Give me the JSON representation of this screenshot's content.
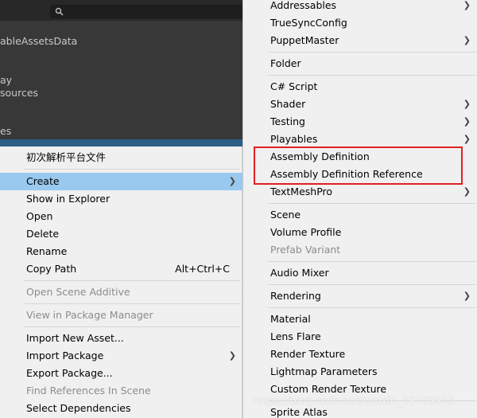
{
  "editor": {
    "search_placeholder": "",
    "labels": [
      "ableAssetsData",
      "ay",
      "sources",
      "es"
    ]
  },
  "main_menu": {
    "items": [
      {
        "label": "初次解析平台文件"
      },
      {
        "label": "Create",
        "submenu": true
      },
      {
        "label": "Show in Explorer"
      },
      {
        "label": "Open"
      },
      {
        "label": "Delete"
      },
      {
        "label": "Rename"
      },
      {
        "label": "Copy Path",
        "shortcut": "Alt+Ctrl+C"
      },
      {
        "label": "Open Scene Additive",
        "disabled": true
      },
      {
        "label": "View in Package Manager",
        "disabled": true
      },
      {
        "label": "Import New Asset..."
      },
      {
        "label": "Import Package",
        "submenu": true
      },
      {
        "label": "Export Package..."
      },
      {
        "label": "Find References In Scene",
        "disabled": true
      },
      {
        "label": "Select Dependencies"
      }
    ]
  },
  "create_submenu": {
    "items": [
      {
        "label": "Addressables",
        "submenu": true
      },
      {
        "label": "TrueSyncConfig"
      },
      {
        "label": "PuppetMaster",
        "submenu": true
      },
      {
        "label": "Folder"
      },
      {
        "label": "C# Script"
      },
      {
        "label": "Shader",
        "submenu": true
      },
      {
        "label": "Testing",
        "submenu": true
      },
      {
        "label": "Playables",
        "submenu": true
      },
      {
        "label": "Assembly Definition"
      },
      {
        "label": "Assembly Definition Reference"
      },
      {
        "label": "TextMeshPro",
        "submenu": true
      },
      {
        "label": "Scene"
      },
      {
        "label": "Volume Profile"
      },
      {
        "label": "Prefab Variant",
        "disabled": true
      },
      {
        "label": "Audio Mixer"
      },
      {
        "label": "Rendering",
        "submenu": true
      },
      {
        "label": "Material"
      },
      {
        "label": "Lens Flare"
      },
      {
        "label": "Render Texture"
      },
      {
        "label": "Lightmap Parameters"
      },
      {
        "label": "Custom Render Texture"
      },
      {
        "label": "Sprite Atlas"
      }
    ]
  },
  "colors": {
    "highlight": "#99c9ef",
    "callout_border": "#e02020",
    "editor_dark": "#383838"
  },
  "icons": {
    "submenu_arrow": "chevron-right-icon",
    "search": "search-icon"
  },
  "watermark": "https://blog.csdn.net/weixin_39709943"
}
